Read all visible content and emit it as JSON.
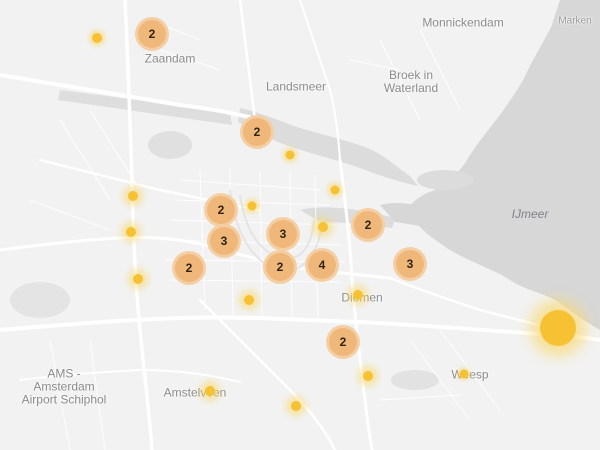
{
  "map": {
    "colors": {
      "land": "#f2f2f2",
      "water": "#d7d7d7",
      "road": "#ffffff",
      "label": "#8a8a8a",
      "cluster_fill": "#f0b77a",
      "cluster_ring": "#f4cfa4",
      "point_fill": "#f6c233",
      "point_halo": "#f9d96e"
    },
    "labels": {
      "zaandam": "Zaandam",
      "landsmeer": "Landsmeer",
      "monnickendam": "Monnickendam",
      "marken": "Marken",
      "broek": "Broek in\nWaterland",
      "ijmeer": "IJmeer",
      "diemen": "Diemen",
      "weesp": "Weesp",
      "amstelveen": "Amstelveen",
      "airport": "AMS -\nAmsterdam\nAirport Schiphol"
    },
    "clusters": [
      {
        "id": "zaandam",
        "count": "2"
      },
      {
        "id": "north",
        "count": "2"
      },
      {
        "id": "west",
        "count": "2"
      },
      {
        "id": "center-w",
        "count": "3"
      },
      {
        "id": "center",
        "count": "3"
      },
      {
        "id": "east",
        "count": "2"
      },
      {
        "id": "sw",
        "count": "2"
      },
      {
        "id": "center-s",
        "count": "2"
      },
      {
        "id": "oost",
        "count": "4"
      },
      {
        "id": "ijburg",
        "count": "3"
      },
      {
        "id": "south-e",
        "count": "2"
      }
    ]
  }
}
